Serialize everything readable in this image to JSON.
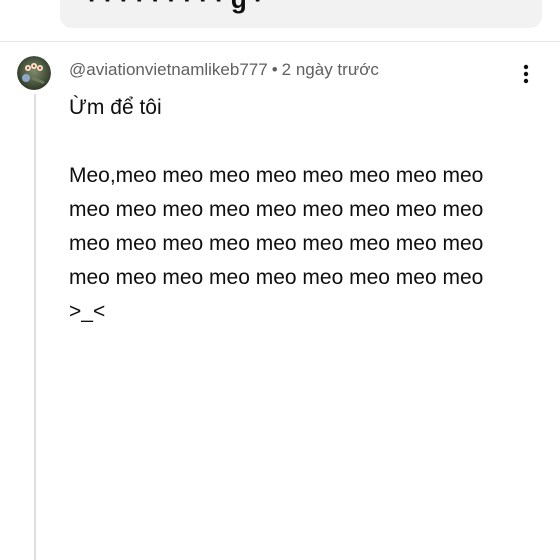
{
  "comment": {
    "author": "@aviationvietnamlikeb777",
    "separator": "•",
    "timestamp": "2 ngày trước",
    "text": "Ừm để tôi\n\nMeo,meo meo meo meo meo meo meo meo meo meo meo meo meo meo meo meo meo meo meo meo meo meo meo meo meo meo meo meo meo meo meo meo meo meo meo\n>_<",
    "avatar_icon": "avatar-icon",
    "more_icon": "more-vertical-icon"
  },
  "colors": {
    "meta_text": "#606060",
    "body_text": "#0f0f0f",
    "thread_line": "#e0e0e0",
    "top_card_bg": "#f2f2f2"
  }
}
